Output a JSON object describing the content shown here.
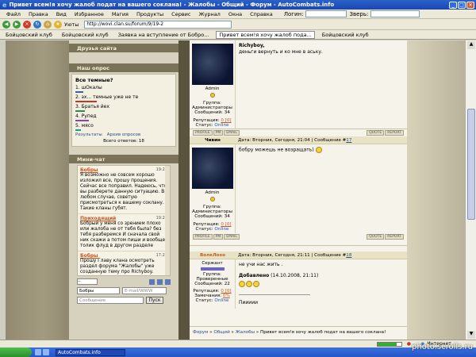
{
  "window": {
    "title": "Привет всем!я хочу жалоб подат на вашего соклана! - Жалобы - Общий - Форум - AutoCombats.info"
  },
  "menubar": {
    "items": [
      "Файл",
      "Правка",
      "Вид",
      "Избранное",
      "Магия",
      "Продукты",
      "Сервис",
      "Журнал",
      "Окна",
      "Справка"
    ],
    "login_label": "Логин:",
    "zver_label": "Зверь:"
  },
  "toolbar": {
    "uyuty_label": "Уюты",
    "address_value": "http://wovi.clan.su/forum/9/19-2"
  },
  "linksbar": {
    "items": [
      "Бойцовский клуб",
      "Бойцовский клуб",
      "Заявка на вступление от Бобро...",
      "Привет всем!я хочу жалоб пода...",
      "Бойцовский клуб"
    ]
  },
  "sidebar": {
    "friends_header": "Друзья сайта",
    "poll_header": "Наш опрос",
    "poll": {
      "question": "Все темные?",
      "options": [
        {
          "label": "1. шОкалы",
          "color": "#3a5fa6",
          "share": 0.08
        },
        {
          "label": "2. эх... темные уже не те",
          "color": "#c0392b",
          "share": 0.22
        },
        {
          "label": "3. Братья йех",
          "color": "#2e8b57",
          "share": 0.1
        },
        {
          "label": "4. Рупед",
          "color": "#8e44ad",
          "share": 0.14
        },
        {
          "label": "5. мясо",
          "color": "#16a085",
          "share": 0.06
        }
      ],
      "results_link": "Результаты",
      "archive_link": "Архив опросов",
      "total": "Всего ответов: 18"
    },
    "chat_header": "Мини-чат",
    "chat": [
      {
        "name": "Бобры",
        "time": "19:28",
        "text": "Я возможно не совсем хорошо изложил все, прошу прощения. Сейчас все поправил. Надеюсь, что вы разберете данную ситуацию. В любом случае, советую присмотреться к вашему соклану. Такие кланы губят."
      },
      {
        "name": "Приходящий",
        "time": "19:21",
        "text": "Бобрый у меня со зрением плохо или жалоба не от тебя была? без тебя разберемся И сначала свой ник скажи а потом пиши и вообще толик флуд в другом разделе"
      },
      {
        "name": "Бобры",
        "time": "17:22",
        "text": "Прошу Главу клана осмотреть раздел форума \"Жалобы\" уже созданную тему про Richyboy."
      }
    ],
    "chat_name_value": "Бобры",
    "chat_email_placeholder": "E-mail/WWW",
    "chat_message_placeholder": "Сообщение",
    "chat_send": "Пуск"
  },
  "posts": [
    {
      "author": "",
      "role": "Admin",
      "group_label": "Группа:",
      "group": "Администраторы",
      "messages": "Сообщений: 34",
      "rep_label": "Репутация:",
      "rep": "0 [0]",
      "status_label": "Статус:",
      "status": "Online",
      "body_title": "Richyboy,",
      "body": "деньги вернуть и ко мне в аську."
    },
    {
      "author": "Чивин",
      "role": "Admin",
      "group_label": "Группа:",
      "group": "Администраторы",
      "messages": "Сообщений: 34",
      "rep_label": "Репутация:",
      "rep": "0 [0]",
      "status_label": "Статус:",
      "status": "Online",
      "date": "Дата: Вторник, Сегодня, 21:04 | Сообщение #",
      "num": "17",
      "body": "бобру можешь не возращать)"
    },
    {
      "author": "ВолкЛохо",
      "role": "Сержант",
      "group_label": "Группа:",
      "group": "Проверенные",
      "messages": "Сообщений: 22",
      "rep_label": "Репутация:",
      "rep": "0 [0]",
      "warn_label": "Замечания:",
      "warn": "0%",
      "status_label": "Статус:",
      "status": "Online",
      "date": "Дата: Вторник, Сегодня, 21:11 | Сообщение #",
      "num": "18",
      "body": "не учи нас жить .",
      "added": "Добавлено",
      "added_date": "(14.10.2008, 21:11)",
      "sig": "Пиииии"
    }
  ],
  "post_buttons": [
    "PROFILE",
    "PM",
    "EMAIL",
    "QUOTE",
    "REPORT"
  ],
  "breadcrumb": [
    "Форум",
    "Общий",
    "Жалобы",
    "Привет всем!я хочу жалоб подат на вашего соклана!"
  ],
  "statusbar": {
    "zone": "Интернет",
    "progress": 0.8
  },
  "taskbar": {
    "task": "AutoCombats.info"
  },
  "watermark": "photo.scrolls.ru"
}
